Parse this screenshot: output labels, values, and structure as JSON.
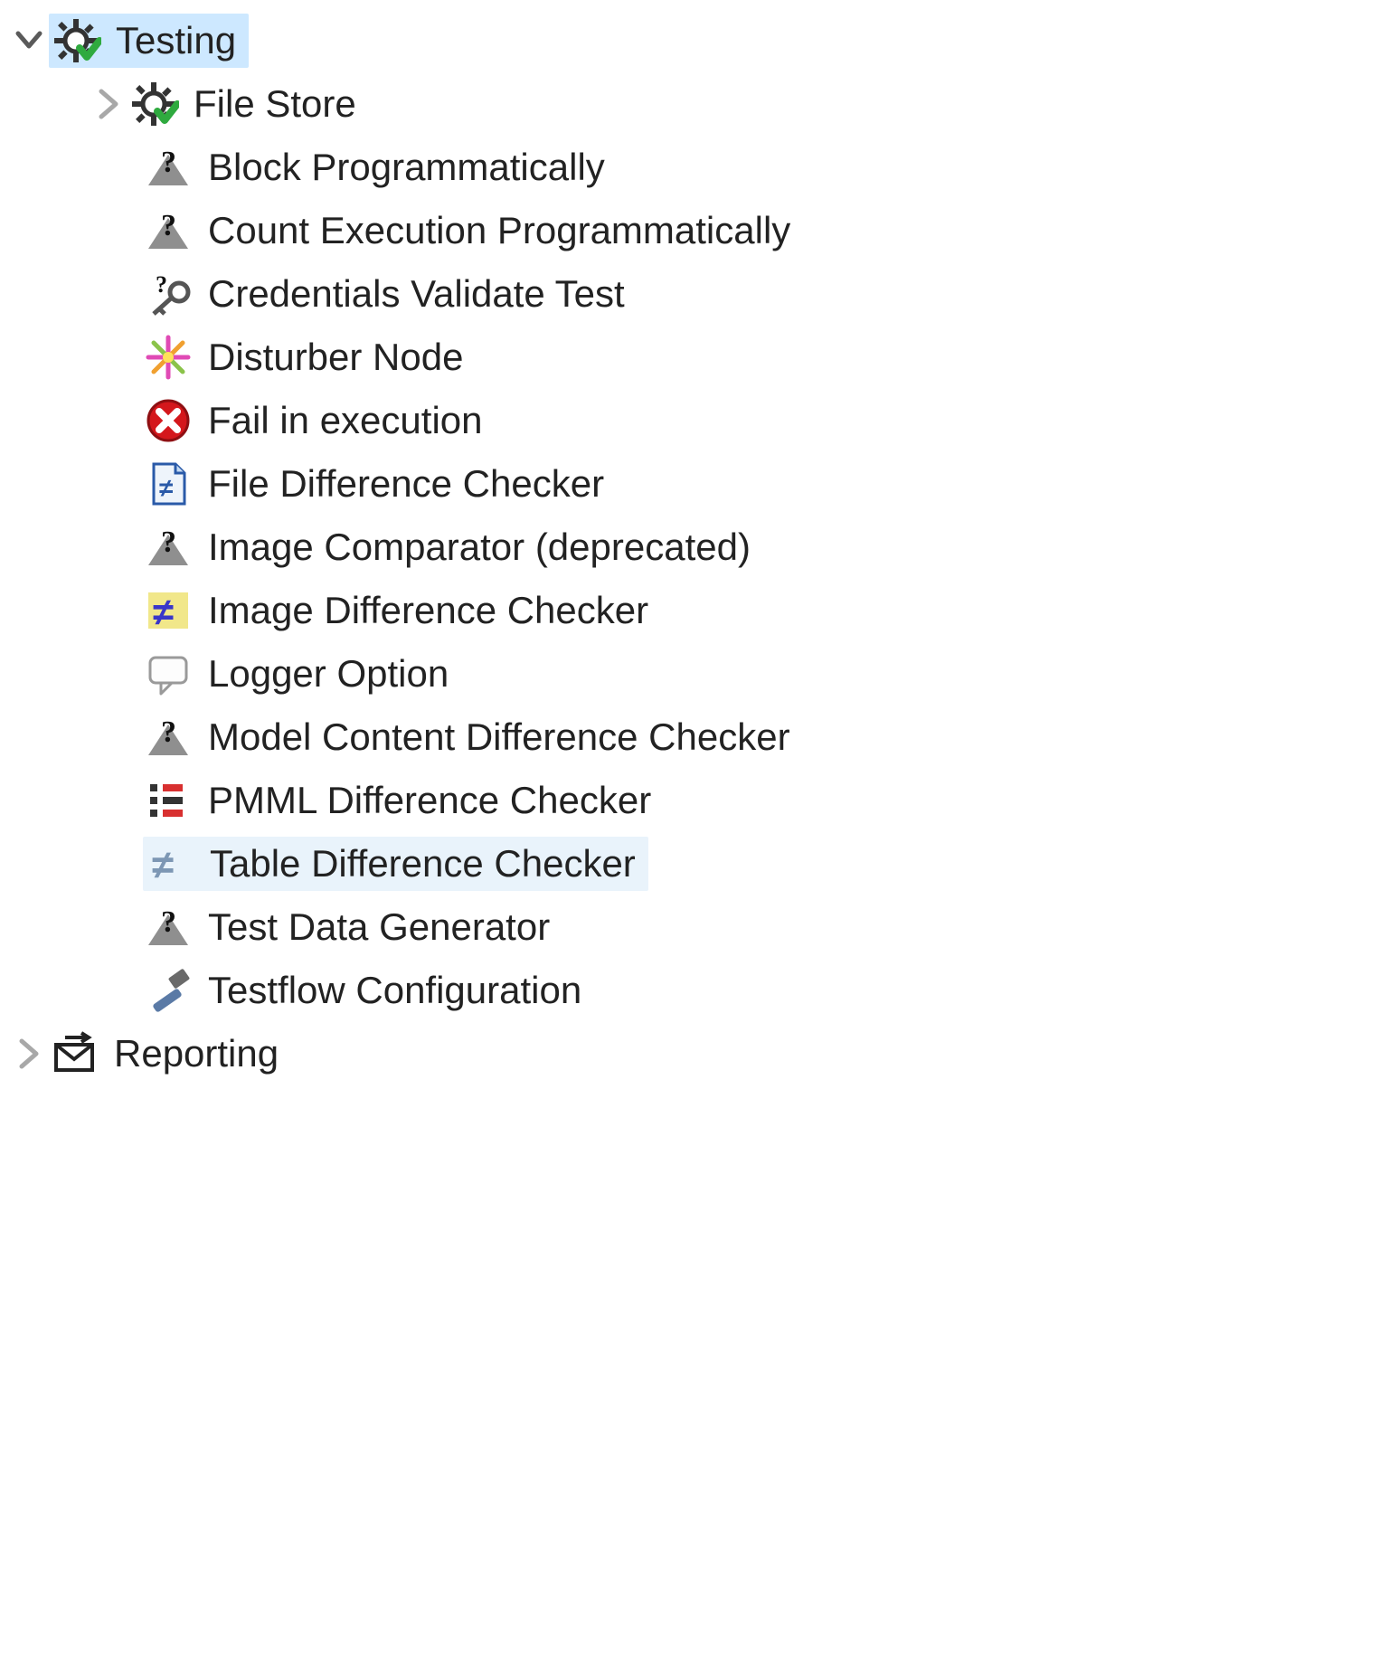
{
  "tree": {
    "testing": {
      "label": "Testing",
      "expanded": true,
      "selected": true,
      "children": [
        {
          "id": "file-store",
          "label": "File Store",
          "icon": "gear-check",
          "expandable": true
        },
        {
          "id": "block-programmatically",
          "label": "Block Programmatically",
          "icon": "question-triangle"
        },
        {
          "id": "count-execution",
          "label": "Count Execution Programmatically",
          "icon": "question-triangle"
        },
        {
          "id": "credentials-validate",
          "label": "Credentials Validate Test",
          "icon": "key-question"
        },
        {
          "id": "disturber-node",
          "label": "Disturber Node",
          "icon": "flower"
        },
        {
          "id": "fail-in-execution",
          "label": "Fail in execution",
          "icon": "error-circle"
        },
        {
          "id": "file-diff-checker",
          "label": "File Difference Checker",
          "icon": "file-neq"
        },
        {
          "id": "image-comparator",
          "label": "Image Comparator (deprecated)",
          "icon": "question-triangle"
        },
        {
          "id": "image-diff-checker",
          "label": "Image Difference Checker",
          "icon": "neq-blue"
        },
        {
          "id": "logger-option",
          "label": "Logger Option",
          "icon": "speech-bubble"
        },
        {
          "id": "model-content-diff",
          "label": "Model Content Difference Checker",
          "icon": "question-triangle"
        },
        {
          "id": "pmml-diff-checker",
          "label": "PMML Difference Checker",
          "icon": "pmml-diff"
        },
        {
          "id": "table-diff-checker",
          "label": "Table Difference Checker",
          "icon": "neq-slate",
          "selected": true
        },
        {
          "id": "test-data-generator",
          "label": "Test Data Generator",
          "icon": "question-triangle"
        },
        {
          "id": "testflow-config",
          "label": "Testflow Configuration",
          "icon": "hammer"
        }
      ]
    },
    "reporting": {
      "label": "Reporting",
      "expanded": false
    }
  }
}
